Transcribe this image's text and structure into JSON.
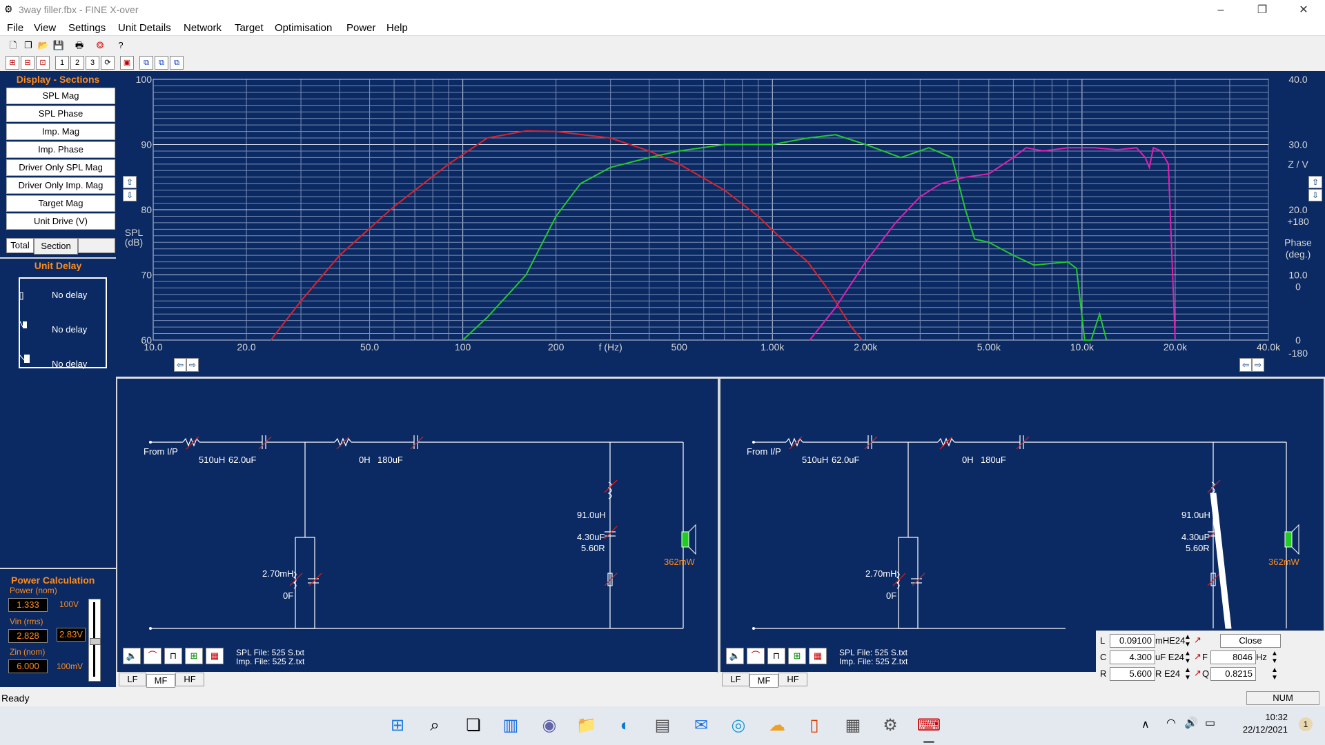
{
  "window": {
    "title": "3way filler.fbx - FINE X-over",
    "min_icon": "–",
    "max_icon": "❐",
    "close_icon": "✕"
  },
  "menu": [
    "File",
    "View",
    "Settings",
    "Unit Details",
    "Network",
    "Target",
    "Optimisation",
    "Power",
    "Help"
  ],
  "toolbar2": [
    "1",
    "2",
    "3"
  ],
  "display": {
    "title": "Display - Sections",
    "buttons": [
      "SPL Mag",
      "SPL Phase",
      "Imp. Mag",
      "Imp. Phase",
      "Driver Only SPL Mag",
      "Driver Only Imp. Mag",
      "Target Mag",
      "Unit Drive (V)"
    ],
    "total": "Total",
    "section": "Section"
  },
  "unit_delay": {
    "title": "Unit Delay",
    "items": [
      "No delay",
      "No delay",
      "No delay"
    ]
  },
  "power": {
    "title": "Power Calculation",
    "power_label": "Power (nom)",
    "power_value": "1.333",
    "power_unit": "100V",
    "vin_label": "Vin (rms)",
    "vin_value": "2.828",
    "vin_box": "2.83V",
    "zin_label": "Zin (nom)",
    "zin_value": "6.000",
    "zin_unit": "100mV"
  },
  "chart_data": {
    "type": "line",
    "x_scale": "log",
    "xlim": [
      10,
      40000
    ],
    "ylim": [
      60,
      100
    ],
    "xlabel": "f (Hz)",
    "ylabel": "SPL (dB)",
    "y_right_label": "Z / V",
    "phase_label": "Phase (deg.)",
    "x_ticks": [
      {
        "v": 10,
        "t": "10.0"
      },
      {
        "v": 20,
        "t": "20.0"
      },
      {
        "v": 50,
        "t": "50.0"
      },
      {
        "v": 100,
        "t": "100"
      },
      {
        "v": 200,
        "t": "200"
      },
      {
        "v": 300,
        "t": "f (Hz)"
      },
      {
        "v": 500,
        "t": "500"
      },
      {
        "v": 1000,
        "t": "1.00k"
      },
      {
        "v": 2000,
        "t": "2.00k"
      },
      {
        "v": 5000,
        "t": "5.00k"
      },
      {
        "v": 10000,
        "t": "10.0k"
      },
      {
        "v": 20000,
        "t": "20.0k"
      },
      {
        "v": 40000,
        "t": "40.0k"
      }
    ],
    "y_ticks": [
      100,
      90,
      80,
      70,
      60
    ],
    "y_right_ticks": [
      {
        "y": 100,
        "t": "40.0"
      },
      {
        "y": 90,
        "t": "30.0"
      },
      {
        "y": 87,
        "t": "Z / V"
      },
      {
        "y": 80,
        "t": "20.0"
      },
      {
        "y": 78.2,
        "t": "+180"
      },
      {
        "y": 75,
        "t": "Phase"
      },
      {
        "y": 73.2,
        "t": "(deg.)"
      },
      {
        "y": 70,
        "t": "10.0"
      },
      {
        "y": 68.2,
        "t": "0"
      },
      {
        "y": 60,
        "t": "0"
      },
      {
        "y": 58,
        "t": "-180"
      }
    ],
    "series": [
      {
        "color": "#e0202a",
        "points": [
          [
            24,
            60
          ],
          [
            30,
            66
          ],
          [
            40,
            73
          ],
          [
            60,
            80.5
          ],
          [
            90,
            87
          ],
          [
            120,
            91
          ],
          [
            160,
            92.1
          ],
          [
            200,
            92
          ],
          [
            300,
            91
          ],
          [
            400,
            89
          ],
          [
            500,
            87
          ],
          [
            700,
            83
          ],
          [
            900,
            79
          ],
          [
            1100,
            75
          ],
          [
            1300,
            72
          ],
          [
            1500,
            68
          ],
          [
            1800,
            62
          ],
          [
            1950,
            60
          ]
        ]
      },
      {
        "color": "#22c92a",
        "points": [
          [
            100,
            60
          ],
          [
            120,
            63.5
          ],
          [
            160,
            70
          ],
          [
            200,
            79
          ],
          [
            240,
            84
          ],
          [
            300,
            86.5
          ],
          [
            400,
            88
          ],
          [
            500,
            89
          ],
          [
            700,
            90
          ],
          [
            1000,
            90
          ],
          [
            1300,
            91
          ],
          [
            1600,
            91.5
          ],
          [
            2000,
            90
          ],
          [
            2600,
            88
          ],
          [
            3200,
            89.5
          ],
          [
            3800,
            88
          ],
          [
            4200,
            80
          ],
          [
            4500,
            75.5
          ],
          [
            5000,
            75
          ],
          [
            6000,
            73
          ],
          [
            7000,
            71.5
          ],
          [
            9000,
            72
          ],
          [
            9600,
            71
          ],
          [
            10200,
            60
          ],
          [
            10700,
            60
          ],
          [
            11400,
            64
          ],
          [
            12000,
            60
          ]
        ]
      },
      {
        "color": "#e020b0",
        "points": [
          [
            1320,
            60
          ],
          [
            1600,
            65
          ],
          [
            2000,
            72
          ],
          [
            2500,
            78
          ],
          [
            3000,
            82
          ],
          [
            3500,
            84
          ],
          [
            4200,
            85
          ],
          [
            5000,
            85.5
          ],
          [
            6000,
            88
          ],
          [
            6600,
            89.5
          ],
          [
            7500,
            89
          ],
          [
            9000,
            89.5
          ],
          [
            11000,
            89.5
          ],
          [
            13000,
            89.2
          ],
          [
            15000,
            89.5
          ],
          [
            16000,
            88
          ],
          [
            16500,
            86.5
          ],
          [
            17000,
            89.5
          ],
          [
            18000,
            89
          ],
          [
            19000,
            87
          ],
          [
            20000,
            60
          ]
        ]
      }
    ]
  },
  "schematic_left": {
    "from_ip": "From I/P",
    "l1": "510uH",
    "c1": "62.0uF",
    "l2": "0H",
    "c2": "180uF",
    "lsh": "2.70mH",
    "csh": "0F",
    "l3": "91.0uH",
    "c3": "4.30uF",
    "r3": "5.60R",
    "pw": "362mW",
    "spl_file": "SPL File:  525  S.txt",
    "imp_file": "Imp. File:  525  Z.txt"
  },
  "schematic_right": {
    "from_ip": "From I/P",
    "l1": "510uH",
    "c1": "62.0uF",
    "l2": "0H",
    "c2": "180uF",
    "lsh": "2.70mH",
    "csh": "0F",
    "l3": "91.0uH",
    "c3": "4.30uF",
    "r3": "5.60R",
    "pw": "362mW",
    "spl_file": "SPL File:  525  S.txt",
    "imp_file": "Imp. File:  525  Z.txt"
  },
  "tabs_left": [
    "LF",
    "MF",
    "HF"
  ],
  "tabs_right": [
    "LF",
    "MF",
    "HF"
  ],
  "editor": {
    "l_label": "L",
    "l_value": "0.09100",
    "l_unit": "mHE24",
    "c_label": "C",
    "c_value": "4.300",
    "c_unit": "uF  E24",
    "r_label": "R",
    "r_value": "5.600",
    "r_unit": "R   E24",
    "close": "Close",
    "f_label": "F",
    "f_value": "8046",
    "f_unit": "Hz",
    "q_label": "Q",
    "q_value": "0.8215"
  },
  "status": {
    "left": "Ready",
    "num": "NUM"
  },
  "taskbar": {
    "time": "10:32",
    "date": "22/12/2021",
    "badge": "1"
  }
}
